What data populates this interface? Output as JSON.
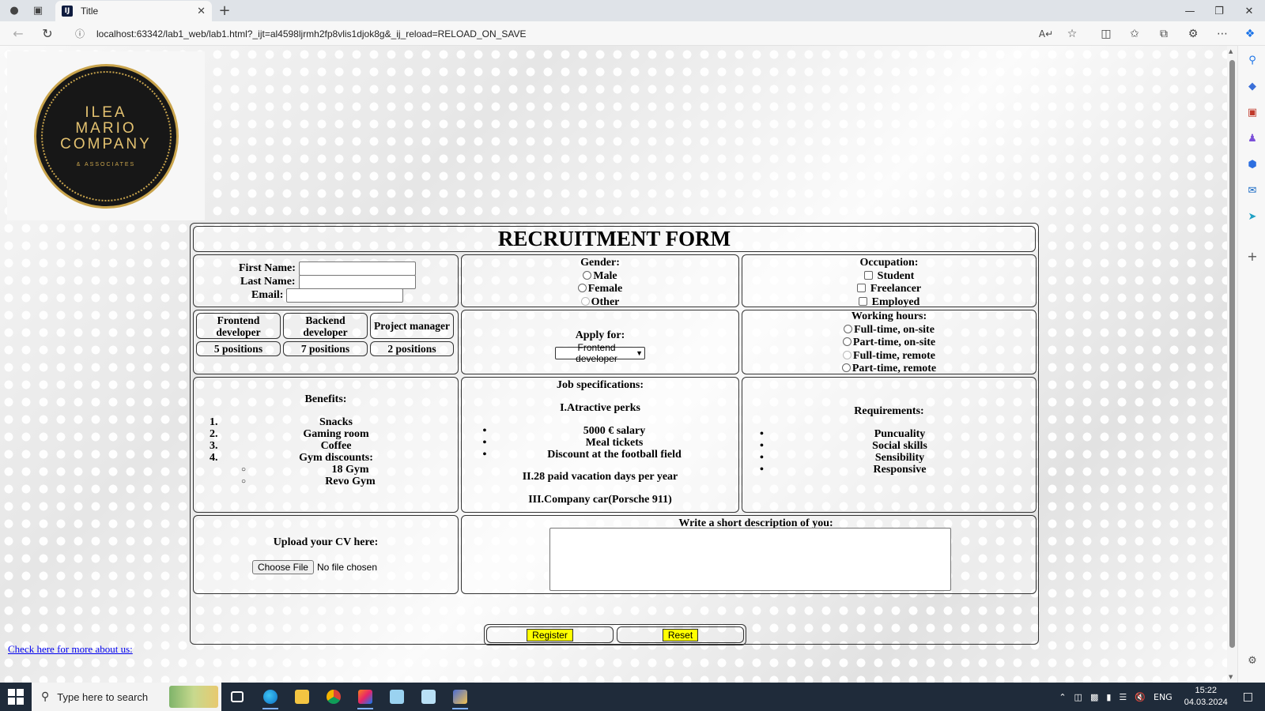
{
  "browser": {
    "tab_title": "Title",
    "tab_favicon": "IJ",
    "url": "localhost:63342/lab1_web/lab1.html?_ijt=al4598ljrmh2fp8vlis1djok8g&_ij_reload=RELOAD_ON_SAVE"
  },
  "logo": {
    "line1": "ILEA",
    "line2": "MARIO",
    "line3": "COMPANY",
    "sub": "& ASSOCIATES"
  },
  "form": {
    "title": "RECRUITMENT FORM",
    "fields": {
      "first_name_label": "First Name:",
      "last_name_label": "Last Name:",
      "email_label": "Email:",
      "first_name_value": "",
      "last_name_value": "",
      "email_value": ""
    },
    "gender": {
      "label": "Gender:",
      "options": [
        "Male",
        "Female",
        "Other"
      ]
    },
    "occupation": {
      "label": "Occupation:",
      "options": [
        "Student",
        "Freelancer",
        "Employed"
      ]
    },
    "positions": [
      {
        "title": "Frontend developer",
        "count": "5 positions"
      },
      {
        "title": "Backend developer",
        "count": "7 positions"
      },
      {
        "title": "Project manager",
        "count": "2 positions"
      }
    ],
    "apply": {
      "label": "Apply for:",
      "selected": "Frontend developer"
    },
    "working_hours": {
      "label": "Working hours:",
      "options": [
        "Full-time, on-site",
        "Part-time, on-site",
        "Full-time, remote",
        "Part-time, remote"
      ]
    },
    "benefits": {
      "label": "Benefits:",
      "items": [
        "Snacks",
        "Gaming room",
        "Coffee",
        "Gym discounts:"
      ],
      "gyms": [
        "18 Gym",
        "Revo Gym"
      ],
      "markers": [
        "1.",
        "2.",
        "3.",
        "4."
      ]
    },
    "job_spec": {
      "label": "Job specifications:",
      "section1": "I.Atractive perks",
      "perks": [
        "5000 € salary",
        "Meal tickets",
        "Discount at the football field"
      ],
      "section2": "II.28 paid vacation days per year",
      "section3": "III.Company car(Porsche 911)"
    },
    "requirements": {
      "label": "Requirements:",
      "items": [
        "Puncuality",
        "Social skills",
        "Sensibility",
        "Responsive"
      ]
    },
    "cv": {
      "label": "Upload your CV here:",
      "button": "Choose File",
      "status": "No file chosen"
    },
    "description": {
      "label": "Write a short description of you:",
      "value": ""
    },
    "buttons": {
      "register": "Register",
      "reset": "Reset"
    }
  },
  "link": {
    "more": "Check here for more about us:"
  },
  "taskbar": {
    "search_placeholder": "Type here to search",
    "language": "ENG",
    "time": "15:22",
    "date": "04.03.2024"
  }
}
